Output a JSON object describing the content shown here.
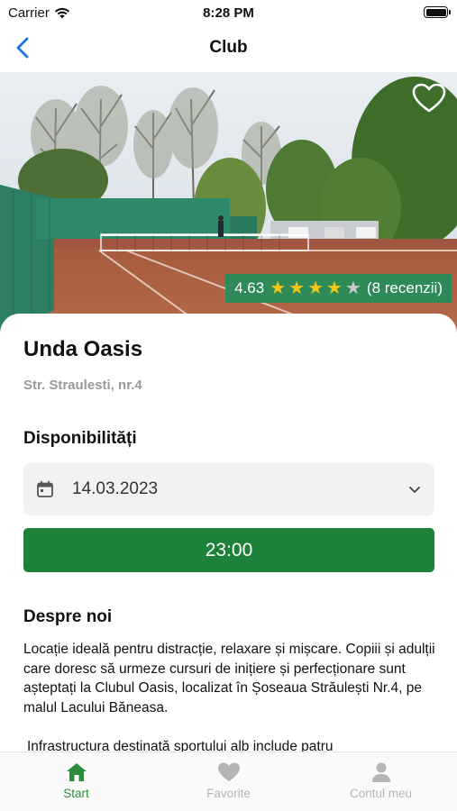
{
  "status_bar": {
    "carrier": "Carrier",
    "time": "8:28 PM"
  },
  "nav": {
    "title": "Club"
  },
  "hero": {
    "rating_value": "4.63",
    "stars": 4,
    "reviews": "(8 recenzii)"
  },
  "club": {
    "name": "Unda Oasis",
    "address": "Str. Straulesti, nr.4"
  },
  "availability": {
    "title": "Disponibilități",
    "date": "14.03.2023",
    "time_slot": "23:00"
  },
  "about": {
    "title": "Despre noi",
    "paragraph_1": "Locație ideală pentru distracție, relaxare și mișcare. Copiii și adulții care doresc să urmeze cursuri de inițiere și perfecționare sunt așteptați la Clubul Oasis, localizat în Șoseaua Străulești Nr.4, pe malul Lacului Băneasa.",
    "paragraph_2": "Infrastructura destinată sportului alb include patru"
  },
  "tabs": [
    {
      "label": "Start",
      "icon": "home-icon",
      "active": true
    },
    {
      "label": "Favorite",
      "icon": "heart-icon",
      "active": false
    },
    {
      "label": "Contul meu",
      "icon": "person-icon",
      "active": false
    }
  ],
  "colors": {
    "accent": "#1e8139",
    "rating_bg": "#2e8b57",
    "star": "#f5c518"
  }
}
